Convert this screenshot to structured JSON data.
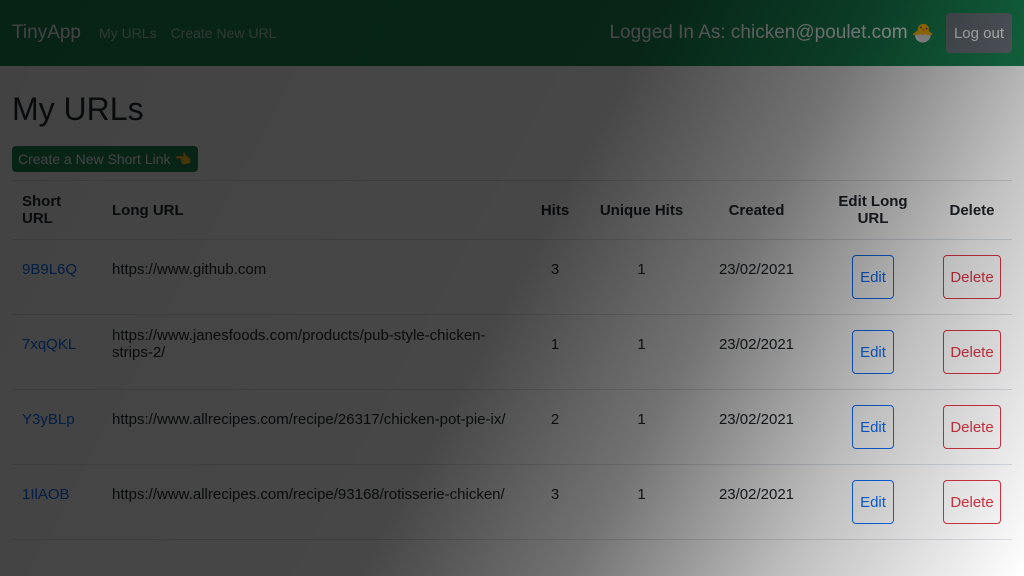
{
  "nav": {
    "brand": "TinyApp",
    "links": [
      "My URLs",
      "Create New URL"
    ],
    "logged_in": "Logged In As: chicken@poulet.com",
    "logout": "Log out"
  },
  "main": {
    "title": "My URLs",
    "create_button": "Create a New Short Link 👈"
  },
  "table": {
    "headers": [
      "Short URL",
      "Long URL",
      "Hits",
      "Unique Hits",
      "Created",
      "Edit Long URL",
      "Delete"
    ],
    "rows": [
      {
        "short": "9B9L6Q",
        "long": "https://www.github.com",
        "hits": "3",
        "unique": "1",
        "created": "23/02/2021",
        "edit": "Edit",
        "delete": "Delete"
      },
      {
        "short": "7xqQKL",
        "long": "https://www.janesfoods.com/products/pub-style-chicken-strips-2/",
        "hits": "1",
        "unique": "1",
        "created": "23/02/2021",
        "edit": "Edit",
        "delete": "Delete"
      },
      {
        "short": "Y3yBLp",
        "long": "https://www.allrecipes.com/recipe/26317/chicken-pot-pie-ix/",
        "hits": "2",
        "unique": "1",
        "created": "23/02/2021",
        "edit": "Edit",
        "delete": "Delete"
      },
      {
        "short": "1IlAOB",
        "long": "https://www.allrecipes.com/recipe/93168/rotisserie-chicken/",
        "hits": "3",
        "unique": "1",
        "created": "23/02/2021",
        "edit": "Edit",
        "delete": "Delete"
      }
    ]
  },
  "colors": {
    "nav": "#198754",
    "link": "#0d6efd",
    "danger": "#dc3545"
  }
}
